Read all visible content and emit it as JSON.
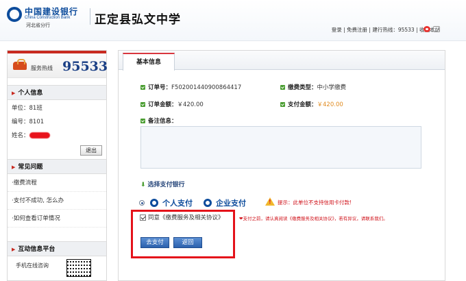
{
  "header": {
    "bank_cn": "中国建设银行",
    "bank_en": "China Construction Bank",
    "branch": "河北省分行",
    "school_name": "正定县弘文中学",
    "links": {
      "login": "登录",
      "register": "免费注册",
      "hotline": "建行热线：95533",
      "bookmark": "收藏本站"
    }
  },
  "sidebar": {
    "hotline_label": "服务热线",
    "hotline_number": "95533",
    "personal_title": "个人信息",
    "unit": "单位：81班",
    "student_no": "编号：8101",
    "name_label": "姓名：",
    "logout": "退出",
    "faq_title": "常见问题",
    "faq_items": [
      "·缴费流程",
      "·支付不成功, 怎么办",
      "·如何查看订单情况"
    ],
    "interact_title": "互动信息平台",
    "consult": "手机在线咨询"
  },
  "main": {
    "tab_label": "基本信息",
    "order_no_label": "订单号：",
    "order_no": "F502001440900864417",
    "fee_type_label": "缴费类型：",
    "fee_type": "中小学缴费",
    "order_amount_label": "订单金额：",
    "order_amount": "￥420.00",
    "pay_amount_label": "支付金额：",
    "pay_amount": "￥420.00",
    "remark_label": "备注信息：",
    "select_bank": "选择支付银行",
    "personal_pay": "个人支付",
    "corporate_pay": "企业支付",
    "warning": "提示：此单位不支持信用卡付款!",
    "agree_label": "同意《缴费服务及相关协议》",
    "agree_note": "❤支付之前，请认真阅读《缴费服务及相关协议》，若有异议，请联系我们。",
    "pay_button": "去支付",
    "back_button": "返回"
  },
  "colors": {
    "brand_blue": "#0d4c9c",
    "accent_red": "#c82a20",
    "highlight_red": "#e4121a",
    "amount_orange": "#e08a1e"
  }
}
